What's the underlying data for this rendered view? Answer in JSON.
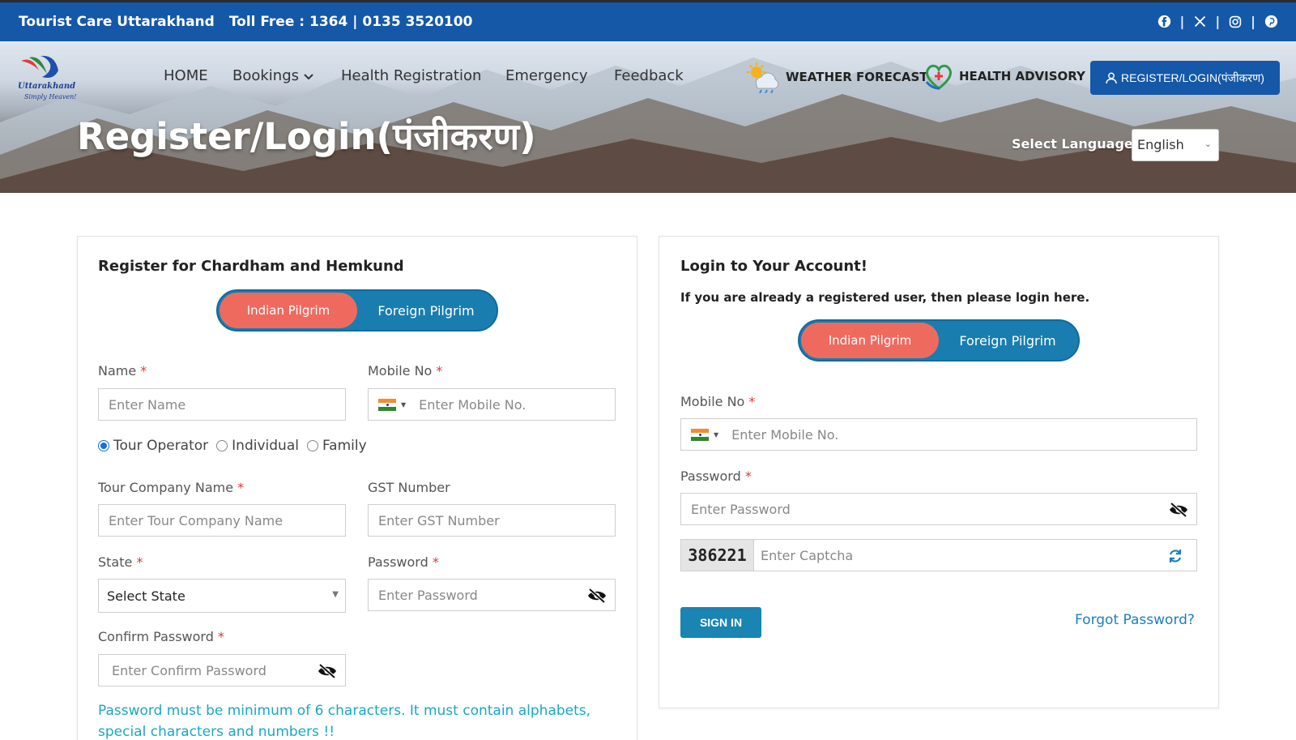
{
  "topbar": {
    "brand": "Tourist Care Uttarakhand",
    "toll_free": "Toll Free : 1364 | 0135 3520100",
    "social_icons": [
      "facebook-icon",
      "x-icon",
      "instagram-icon",
      "pinterest-icon"
    ]
  },
  "logo": {
    "name": "Uttarakhand",
    "tagline": "Simply Heaven!"
  },
  "nav": {
    "items": [
      "HOME",
      "Bookings",
      "Health Registration",
      "Emergency",
      "Feedback"
    ],
    "weather": "WEATHER FORECAST",
    "health": "HEALTH ADVISORY",
    "register": "REGISTER/LOGIN(पंजीकरण)"
  },
  "hero": {
    "title": "Register/Login(पंजीकरण)",
    "language_label": "Select Language",
    "language_value": "English"
  },
  "register": {
    "title": "Register for Chardham and Hemkund",
    "toggle": {
      "active": "Indian Pilgrim",
      "inactive": "Foreign Pilgrim"
    },
    "name_label": "Name",
    "name_placeholder": "Enter Name",
    "mobile_label": "Mobile No",
    "mobile_placeholder": "Enter  Mobile No.",
    "radio": {
      "options": [
        "Tour Operator",
        "Individual",
        "Family"
      ],
      "selected": "Tour Operator"
    },
    "company_label": "Tour Company Name",
    "company_placeholder": "Enter Tour Company Name",
    "gst_label": "GST Number",
    "gst_placeholder": "Enter GST Number",
    "state_label": "State",
    "state_value": "Select State",
    "password_label": "Password",
    "password_placeholder": "Enter  Password",
    "confirm_label": "Confirm Password",
    "confirm_placeholder": "Enter Confirm Password",
    "hint": "Password must be minimum of 6 characters. It must contain alphabets, special characters and numbers !!"
  },
  "login": {
    "title": "Login to Your Account!",
    "subtitle": "If you are already a registered user, then please login here.",
    "toggle": {
      "active": "Indian Pilgrim",
      "inactive": "Foreign Pilgrim"
    },
    "mobile_label": "Mobile No",
    "mobile_placeholder": "Enter  Mobile No.",
    "password_label": "Password",
    "password_placeholder": "Enter  Password",
    "captcha_code": "386221",
    "captcha_placeholder": "Enter Captcha",
    "signin": "SIGN IN",
    "forgot": "Forgot Password?"
  },
  "colors": {
    "primary_blue": "#1558a8",
    "toggle_blue": "#1a7db0",
    "toggle_active": "#ef6a5e",
    "hint_cyan": "#17a8c8",
    "required_red": "#d93a3a"
  }
}
